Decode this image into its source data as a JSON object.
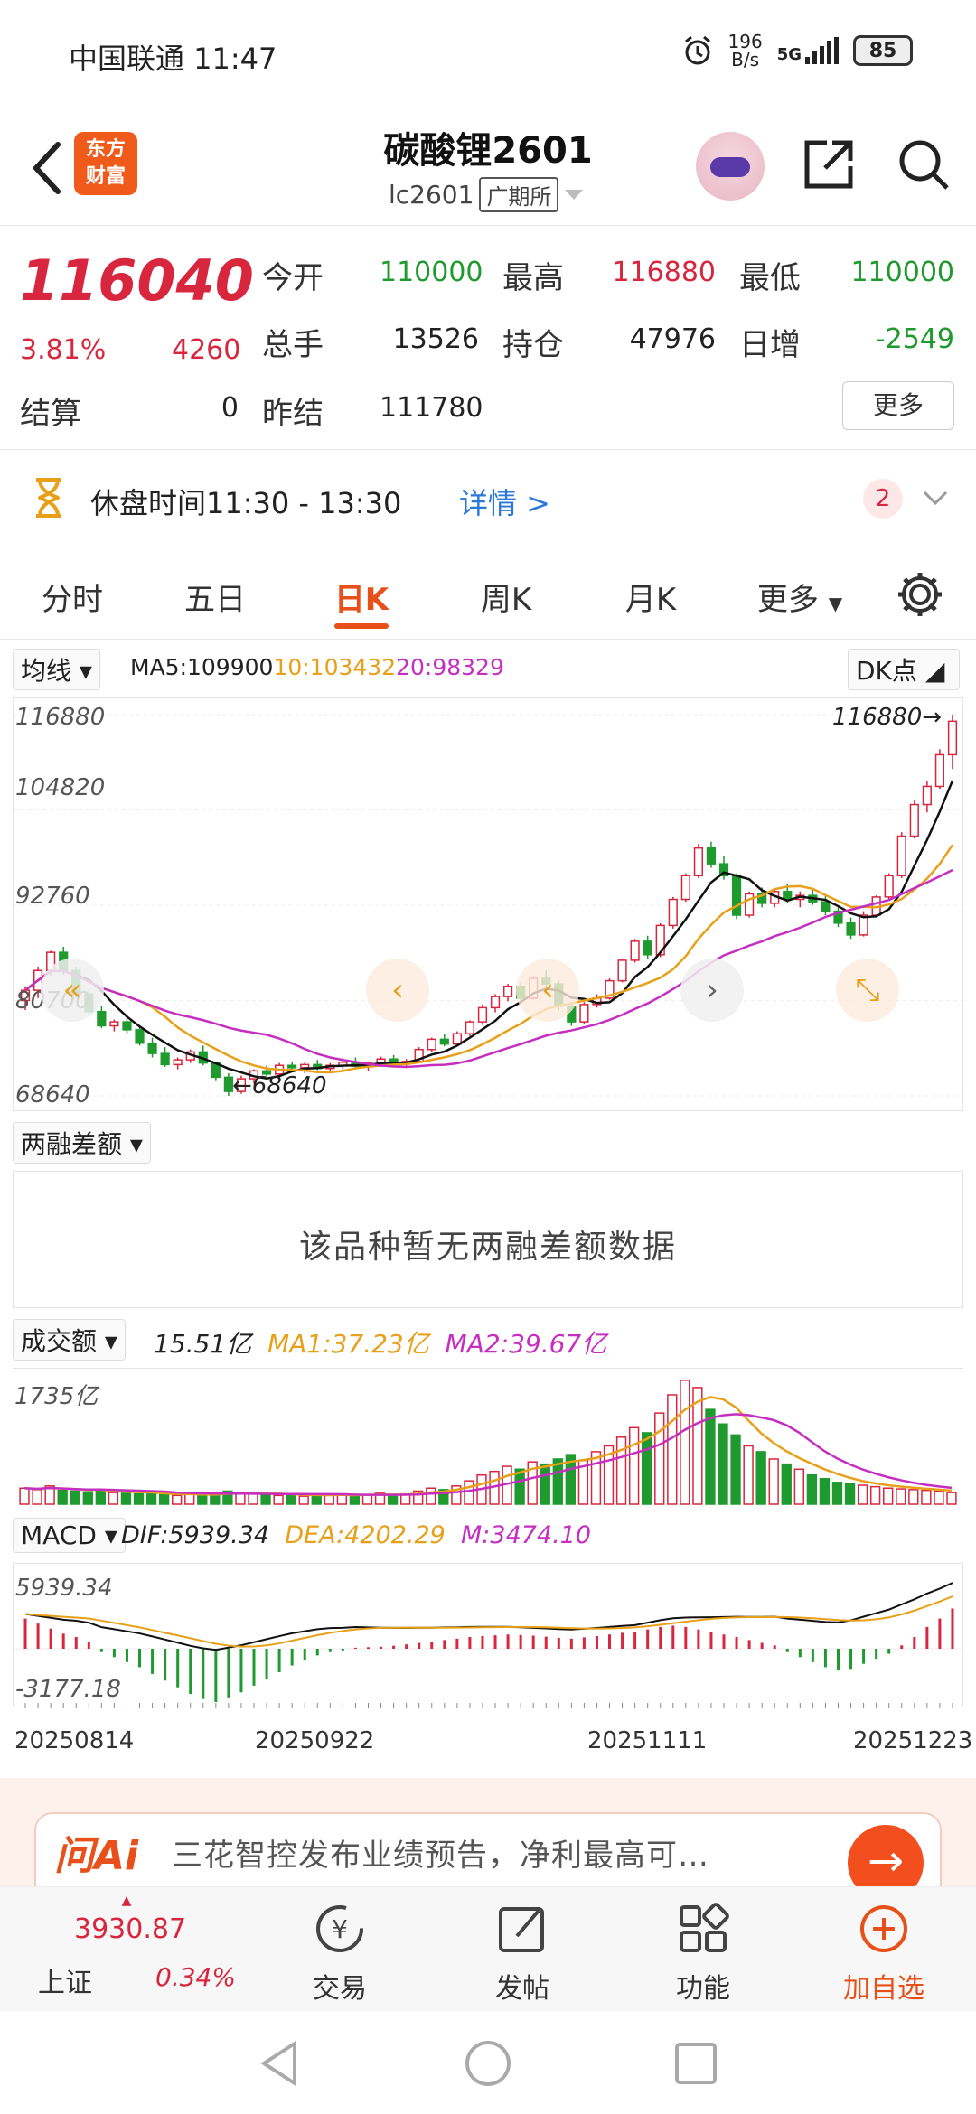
{
  "status_bar": {
    "carrier_time": "中国联通 11:47",
    "net_speed_top": "196",
    "net_speed_bottom": "B/s",
    "network": "5G",
    "battery": "85"
  },
  "header": {
    "title": "碳酸锂2601",
    "code": "lc2601",
    "exchange": "广期所",
    "logo_line1": "东方",
    "logo_line2": "财富"
  },
  "quote": {
    "price": "116040",
    "change_pct": "3.81%",
    "change_abs": "4260",
    "open_label": "今开",
    "open": "110000",
    "high_label": "最高",
    "high": "116880",
    "low_label": "最低",
    "low": "110000",
    "volume_label": "总手",
    "volume": "13526",
    "oi_label": "持仓",
    "oi": "47976",
    "daily_inc_label": "日增",
    "daily_inc": "-2549",
    "settle_label": "结算",
    "settle": "0",
    "prev_settle_label": "昨结",
    "prev_settle": "111780",
    "more": "更多"
  },
  "break_bar": {
    "text": "休盘时间11:30 - 13:30",
    "detail": "详情 >",
    "badge": "2"
  },
  "tabs": [
    "分时",
    "五日",
    "日K",
    "周K",
    "月K",
    "更多"
  ],
  "kline": {
    "ma_selector": "均线",
    "ma5": "MA5:109900",
    "ma10": "10:103432",
    "ma20": "20:98329",
    "dk_button": "DK点",
    "y_top": "116880",
    "y_mid1": "104820",
    "y_mid2": "92760",
    "y_mid3": "80700",
    "y_bottom": "68640",
    "max_marker": "116880",
    "min_marker": "68640"
  },
  "rzce": {
    "selector": "两融差额",
    "message": "该品种暂无两融差额数据"
  },
  "volume": {
    "selector": "成交额",
    "value": "15.51亿",
    "ma1": "MA1:37.23亿",
    "ma2": "MA2:39.67亿",
    "y_top": "1735亿"
  },
  "macd": {
    "selector": "MACD",
    "dif": "DIF:5939.34",
    "dea": "DEA:4202.29",
    "m": "M:3474.10",
    "y_top": "5939.34",
    "y_bottom": "-3177.18"
  },
  "dates": [
    "20250814",
    "20250922",
    "20251111",
    "20251223"
  ],
  "ai_banner": {
    "logo": "问Ai",
    "text": "三花智控发布业绩预告，净利最高可…"
  },
  "bottom_nav": {
    "index_value": "3930.87",
    "index_name": "上证",
    "index_change": "0.34%",
    "items": [
      "交易",
      "发帖",
      "功能",
      "加自选"
    ]
  },
  "colors": {
    "up": "#d7263d",
    "down": "#1f9a2e",
    "ma10": "#e8a01a",
    "ma20": "#c62ec2",
    "accent": "#e8501a"
  },
  "chart_data": {
    "type": "candlestick",
    "ylim": [
      68640,
      116880
    ],
    "ohlc": [
      [
        80700,
        82500,
        79500,
        82000
      ],
      [
        82000,
        85000,
        81000,
        84500
      ],
      [
        84500,
        87000,
        83800,
        86800
      ],
      [
        86800,
        87500,
        84000,
        84500
      ],
      [
        84500,
        85000,
        81000,
        81500
      ],
      [
        81500,
        82200,
        79000,
        79300
      ],
      [
        79300,
        80000,
        77200,
        77500
      ],
      [
        77500,
        78300,
        76800,
        78000
      ],
      [
        78000,
        79000,
        76500,
        77000
      ],
      [
        77000,
        77500,
        75000,
        75300
      ],
      [
        75300,
        76000,
        73500,
        74000
      ],
      [
        74000,
        74800,
        72300,
        72600
      ],
      [
        72600,
        73500,
        72000,
        73200
      ],
      [
        73200,
        74500,
        72800,
        74200
      ],
      [
        74200,
        75000,
        72500,
        72800
      ],
      [
        72800,
        73000,
        70500,
        71000
      ],
      [
        71000,
        71500,
        68640,
        69200
      ],
      [
        69200,
        71200,
        68900,
        70800
      ],
      [
        70800,
        72000,
        70200,
        71800
      ],
      [
        71800,
        72500,
        71000,
        71400
      ],
      [
        71400,
        72800,
        71000,
        72500
      ],
      [
        72500,
        73000,
        71800,
        72200
      ],
      [
        72200,
        72900,
        71500,
        72600
      ],
      [
        72600,
        73200,
        71900,
        72100
      ],
      [
        72100,
        72800,
        71600,
        72500
      ],
      [
        72500,
        73400,
        72000,
        72900
      ],
      [
        72900,
        73500,
        72200,
        72400
      ],
      [
        72400,
        73000,
        71800,
        72800
      ],
      [
        72800,
        73600,
        72300,
        73300
      ],
      [
        73300,
        73800,
        72500,
        72700
      ],
      [
        72700,
        73300,
        72200,
        73000
      ],
      [
        73000,
        74800,
        72800,
        74500
      ],
      [
        74500,
        76000,
        74200,
        75800
      ],
      [
        75800,
        76500,
        74900,
        75200
      ],
      [
        75200,
        76800,
        75000,
        76500
      ],
      [
        76500,
        78200,
        76200,
        78000
      ],
      [
        78000,
        80200,
        77600,
        79800
      ],
      [
        79800,
        81500,
        79200,
        81200
      ],
      [
        81200,
        82800,
        80600,
        82500
      ],
      [
        82500,
        83000,
        80500,
        81000
      ],
      [
        81000,
        83800,
        80800,
        83500
      ],
      [
        83500,
        84500,
        82400,
        82800
      ],
      [
        82800,
        83200,
        79500,
        80000
      ],
      [
        80000,
        80500,
        77500,
        78000
      ],
      [
        78000,
        80500,
        77800,
        80200
      ],
      [
        80200,
        81500,
        79800,
        81000
      ],
      [
        81000,
        83500,
        80800,
        83200
      ],
      [
        83200,
        86000,
        83000,
        85800
      ],
      [
        85800,
        88500,
        85500,
        88200
      ],
      [
        88200,
        88900,
        86000,
        86500
      ],
      [
        86500,
        90500,
        86200,
        90200
      ],
      [
        90200,
        93800,
        89800,
        93500
      ],
      [
        93500,
        96800,
        93200,
        96500
      ],
      [
        96500,
        100500,
        96200,
        100000
      ],
      [
        100000,
        100800,
        97500,
        98000
      ],
      [
        98000,
        99000,
        96000,
        96500
      ],
      [
        96500,
        96800,
        91000,
        91500
      ],
      [
        91500,
        94500,
        91200,
        94200
      ],
      [
        94200,
        95000,
        92500,
        93000
      ],
      [
        93000,
        94800,
        92500,
        94500
      ],
      [
        94500,
        95500,
        93000,
        93500
      ],
      [
        93500,
        94500,
        92500,
        94000
      ],
      [
        94000,
        94800,
        92800,
        93200
      ],
      [
        93200,
        93900,
        91500,
        92000
      ],
      [
        92000,
        92500,
        90000,
        90500
      ],
      [
        90500,
        91200,
        88500,
        89000
      ],
      [
        89000,
        92000,
        88800,
        91500
      ],
      [
        91500,
        94000,
        91200,
        93800
      ],
      [
        93800,
        96800,
        93500,
        96500
      ],
      [
        96500,
        102000,
        96200,
        101500
      ],
      [
        101500,
        106000,
        101200,
        105500
      ],
      [
        105500,
        108500,
        104500,
        107800
      ],
      [
        107800,
        112500,
        107500,
        111800
      ],
      [
        111800,
        116880,
        110000,
        116040
      ]
    ],
    "volume": [
      22,
      20,
      25,
      19,
      18,
      17,
      20,
      16,
      15,
      14,
      16,
      13,
      12,
      14,
      12,
      15,
      18,
      16,
      14,
      13,
      12,
      14,
      11,
      13,
      12,
      14,
      12,
      13,
      15,
      12,
      14,
      18,
      22,
      20,
      25,
      32,
      40,
      45,
      52,
      48,
      58,
      55,
      62,
      68,
      60,
      72,
      80,
      92,
      105,
      98,
      125,
      150,
      170,
      160,
      130,
      110,
      95,
      80,
      72,
      62,
      55,
      48,
      40,
      35,
      30,
      28,
      26,
      24,
      22,
      21,
      20,
      19,
      18,
      16
    ],
    "macd_hist": [
      1800,
      1500,
      1200,
      900,
      700,
      400,
      -200,
      -500,
      -800,
      -1100,
      -1500,
      -1900,
      -2300,
      -2700,
      -3000,
      -3177,
      -2900,
      -2600,
      -2200,
      -1800,
      -1400,
      -1000,
      -700,
      -400,
      -200,
      -100,
      60,
      90,
      120,
      180,
      260,
      350,
      420,
      520,
      600,
      700,
      760,
      800,
      850,
      820,
      780,
      720,
      650,
      600,
      680,
      760,
      850,
      950,
      1000,
      1150,
      1300,
      1380,
      1300,
      1150,
      1000,
      850,
      700,
      520,
      350,
      200,
      -200,
      -500,
      -800,
      -1100,
      -1300,
      -1200,
      -900,
      -600,
      -300,
      200,
      700,
      1300,
      1800,
      2400
    ]
  }
}
